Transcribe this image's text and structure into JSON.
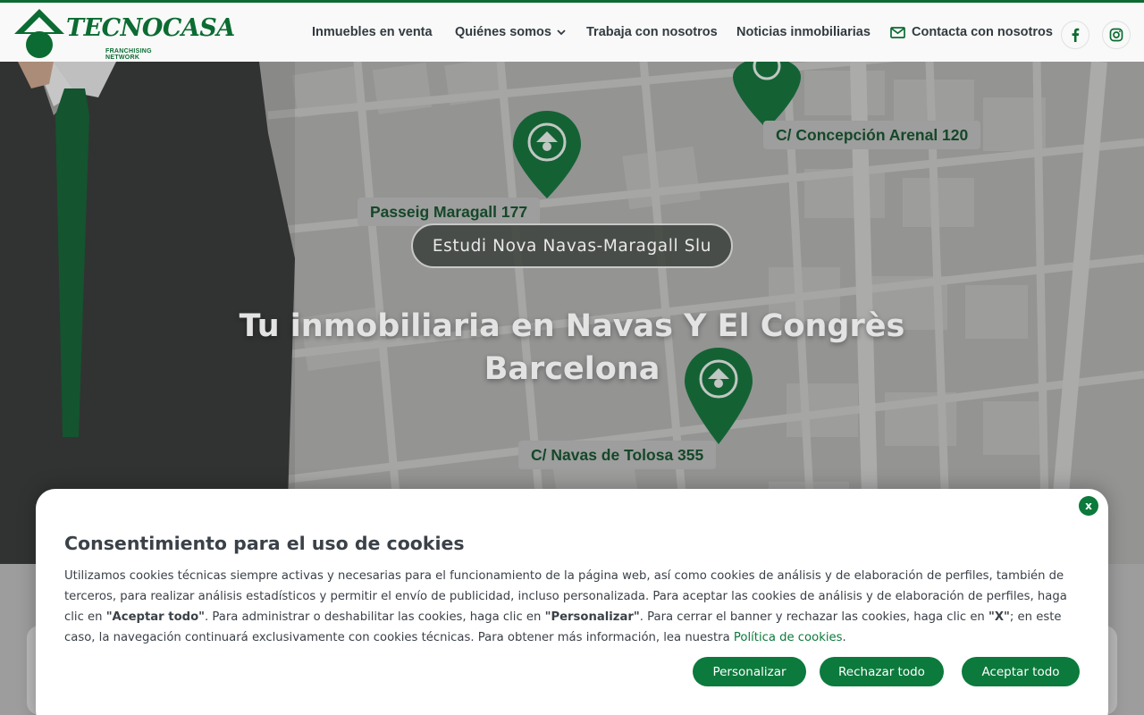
{
  "brand": {
    "name": "TECNOCASA",
    "tagline": "FRANCHISING NETWORK",
    "color": "#0b6b32"
  },
  "nav": {
    "items": [
      {
        "label": "Inmuebles en venta"
      },
      {
        "label": "Quiénes somos",
        "icon": "chevron-down-icon"
      },
      {
        "label": "Trabaja con nosotros"
      },
      {
        "label": "Noticias inmobiliarias"
      },
      {
        "label": "Contacta con nosotros",
        "icon": "mail-icon"
      }
    ],
    "social": [
      {
        "icon": "facebook-icon"
      },
      {
        "icon": "instagram-icon"
      }
    ]
  },
  "hero": {
    "agency_badge": "Estudi Nova Navas-Maragall Slu",
    "title_line1": "Tu inmobiliaria en Navas Y El Congrès",
    "title_line2": "Barcelona",
    "map_labels": [
      "C/ Concepción Arenal 120",
      "Passeig Maragall 177",
      "C/ Navas de Tolosa 355"
    ]
  },
  "cookies": {
    "close_label": "x",
    "title": "Consentimiento para el uso de cookies",
    "body_part1": "Utilizamos cookies técnicas siempre activas y necesarias para el funcionamiento de la página web, así como cookies de análisis y de elaboración de perfiles, también de terceros, para realizar análisis estadísticos y permitir el envío de publicidad, incluso personalizada. Para aceptar las cookies de análisis y de elaboración de perfiles, haga clic en ",
    "accept_quote": "\"Aceptar todo\"",
    "body_part2": ". Para administrar o deshabilitar las cookies, haga clic en ",
    "customize_quote": "\"Personalizar\"",
    "body_part3": ". Para cerrar el banner y rechazar las cookies, haga clic en ",
    "x_quote": "\"X\"",
    "body_part4": "; en este caso, la navegación continuará exclusivamente con cookies técnicas. Para obtener más información, lea nuestra ",
    "policy_link": "Política de cookies",
    "body_end": ".",
    "buttons": {
      "customize": "Personalizar",
      "reject": "Rechazar todo",
      "accept": "Aceptar todo"
    },
    "accent_color": "#0b7a3c"
  }
}
